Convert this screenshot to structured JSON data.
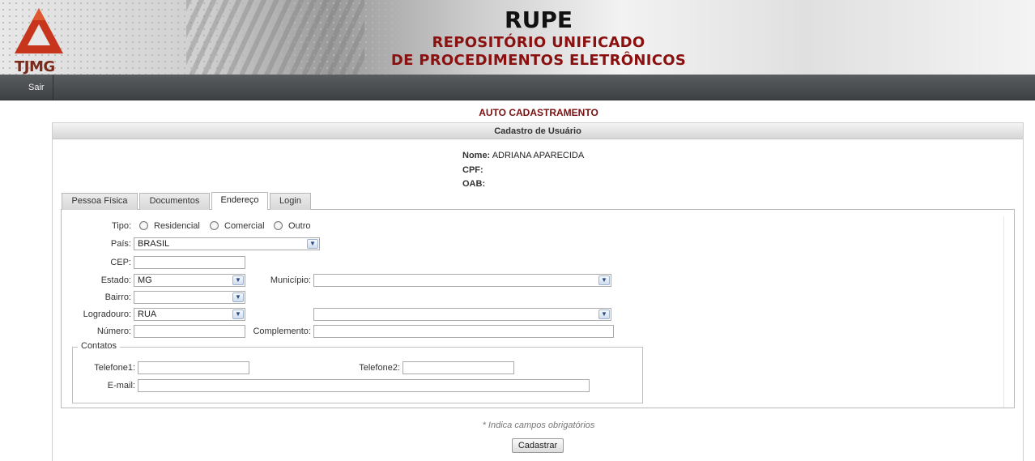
{
  "header": {
    "logo_text": "TJMG",
    "title": "RUPE",
    "subtitle_line1": "REPOSITÓRIO UNIFICADO",
    "subtitle_line2": "DE PROCEDIMENTOS ELETRÔNICOS"
  },
  "nav": {
    "sair": "Sair"
  },
  "page_title": "AUTO CADASTRAMENTO",
  "panel_title": "Cadastro de Usuário",
  "user_info": {
    "nome_label": "Nome:",
    "nome_value": "ADRIANA APARECIDA",
    "cpf_label": "CPF:",
    "cpf_value": "",
    "oab_label": "OAB:",
    "oab_value": ""
  },
  "tabs": [
    {
      "label": "Pessoa Física",
      "active": false
    },
    {
      "label": "Documentos",
      "active": false
    },
    {
      "label": "Endereço",
      "active": true
    },
    {
      "label": "Login",
      "active": false
    }
  ],
  "form": {
    "tipo_label": "Tipo:",
    "tipo_options": [
      "Residencial",
      "Comercial",
      "Outro"
    ],
    "pais_label": "País:",
    "pais_value": "BRASIL",
    "cep_label": "CEP:",
    "cep_value": "",
    "estado_label": "Estado:",
    "estado_value": "MG",
    "municipio_label": "Município:",
    "municipio_value": "",
    "bairro_label": "Bairro:",
    "bairro_value": "",
    "logradouro_label": "Logradouro:",
    "logradouro_type_value": "RUA",
    "logradouro_value": "",
    "numero_label": "Número:",
    "numero_value": "",
    "complemento_label": "Complemento:",
    "complemento_value": ""
  },
  "contatos": {
    "legend": "Contatos",
    "telefone1_label": "Telefone1:",
    "telefone1_value": "",
    "telefone2_label": "Telefone2:",
    "telefone2_value": "",
    "email_label": "E-mail:",
    "email_value": ""
  },
  "required_note": "* Indica campos obrigatórios",
  "submit_label": "Cadastrar",
  "colors": {
    "brand_red": "#8b1111",
    "navbar": "#45484b"
  }
}
